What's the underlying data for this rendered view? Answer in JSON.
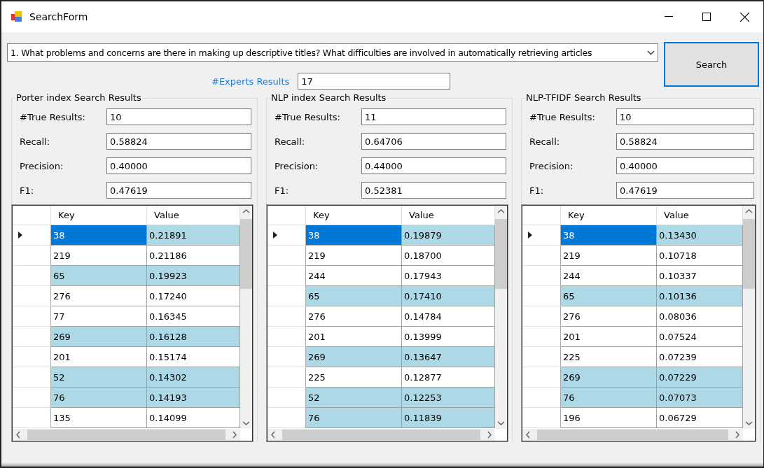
{
  "window": {
    "title": "SearchForm"
  },
  "query": {
    "value": "1.  What problems and concerns are there in making up descriptive titles? What difficulties are involved in automatically retrieving articles"
  },
  "search_button": "Search",
  "experts": {
    "label": "#Experts Results",
    "value": "17"
  },
  "panels": [
    {
      "title": "Porter index Search Results",
      "fields": [
        {
          "label": "#True Results:",
          "value": "10"
        },
        {
          "label": "Recall:",
          "value": "0.58824"
        },
        {
          "label": "Precision:",
          "value": "0.40000"
        },
        {
          "label": "F1:",
          "value": "0.47619"
        }
      ],
      "columns": [
        "Key",
        "Value"
      ],
      "rows": [
        {
          "key": "38",
          "value": "0.21891",
          "highlighted": true,
          "selected": true
        },
        {
          "key": "219",
          "value": "0.21186",
          "highlighted": false,
          "selected": false
        },
        {
          "key": "65",
          "value": "0.19923",
          "highlighted": true,
          "selected": false
        },
        {
          "key": "276",
          "value": "0.17240",
          "highlighted": false,
          "selected": false
        },
        {
          "key": "77",
          "value": "0.16345",
          "highlighted": false,
          "selected": false
        },
        {
          "key": "269",
          "value": "0.16128",
          "highlighted": true,
          "selected": false
        },
        {
          "key": "201",
          "value": "0.15174",
          "highlighted": false,
          "selected": false
        },
        {
          "key": "52",
          "value": "0.14302",
          "highlighted": true,
          "selected": false
        },
        {
          "key": "76",
          "value": "0.14193",
          "highlighted": true,
          "selected": false
        },
        {
          "key": "135",
          "value": "0.14099",
          "highlighted": false,
          "selected": false
        }
      ]
    },
    {
      "title": "NLP index Search Results",
      "fields": [
        {
          "label": "#True Results:",
          "value": "11"
        },
        {
          "label": "Recall:",
          "value": "0.64706"
        },
        {
          "label": "Precision:",
          "value": "0.44000"
        },
        {
          "label": "F1:",
          "value": "0.52381"
        }
      ],
      "columns": [
        "Key",
        "Value"
      ],
      "rows": [
        {
          "key": "38",
          "value": "0.19879",
          "highlighted": true,
          "selected": true
        },
        {
          "key": "219",
          "value": "0.18700",
          "highlighted": false,
          "selected": false
        },
        {
          "key": "244",
          "value": "0.17943",
          "highlighted": false,
          "selected": false
        },
        {
          "key": "65",
          "value": "0.17410",
          "highlighted": true,
          "selected": false
        },
        {
          "key": "276",
          "value": "0.14784",
          "highlighted": false,
          "selected": false
        },
        {
          "key": "201",
          "value": "0.13999",
          "highlighted": false,
          "selected": false
        },
        {
          "key": "269",
          "value": "0.13647",
          "highlighted": true,
          "selected": false
        },
        {
          "key": "225",
          "value": "0.12877",
          "highlighted": false,
          "selected": false
        },
        {
          "key": "52",
          "value": "0.12253",
          "highlighted": true,
          "selected": false
        },
        {
          "key": "76",
          "value": "0.11839",
          "highlighted": true,
          "selected": false
        }
      ]
    },
    {
      "title": "NLP-TFIDF Search Results",
      "fields": [
        {
          "label": "#True Results:",
          "value": "10"
        },
        {
          "label": "Recall:",
          "value": "0.58824"
        },
        {
          "label": "Precision:",
          "value": "0.40000"
        },
        {
          "label": "F1:",
          "value": "0.47619"
        }
      ],
      "columns": [
        "Key",
        "Value"
      ],
      "rows": [
        {
          "key": "38",
          "value": "0.13430",
          "highlighted": true,
          "selected": true
        },
        {
          "key": "219",
          "value": "0.10718",
          "highlighted": false,
          "selected": false
        },
        {
          "key": "244",
          "value": "0.10337",
          "highlighted": false,
          "selected": false
        },
        {
          "key": "65",
          "value": "0.10136",
          "highlighted": true,
          "selected": false
        },
        {
          "key": "276",
          "value": "0.08036",
          "highlighted": false,
          "selected": false
        },
        {
          "key": "201",
          "value": "0.07524",
          "highlighted": false,
          "selected": false
        },
        {
          "key": "225",
          "value": "0.07239",
          "highlighted": false,
          "selected": false
        },
        {
          "key": "269",
          "value": "0.07229",
          "highlighted": true,
          "selected": false
        },
        {
          "key": "76",
          "value": "0.07073",
          "highlighted": true,
          "selected": false
        },
        {
          "key": "196",
          "value": "0.06729",
          "highlighted": false,
          "selected": false
        }
      ]
    }
  ]
}
